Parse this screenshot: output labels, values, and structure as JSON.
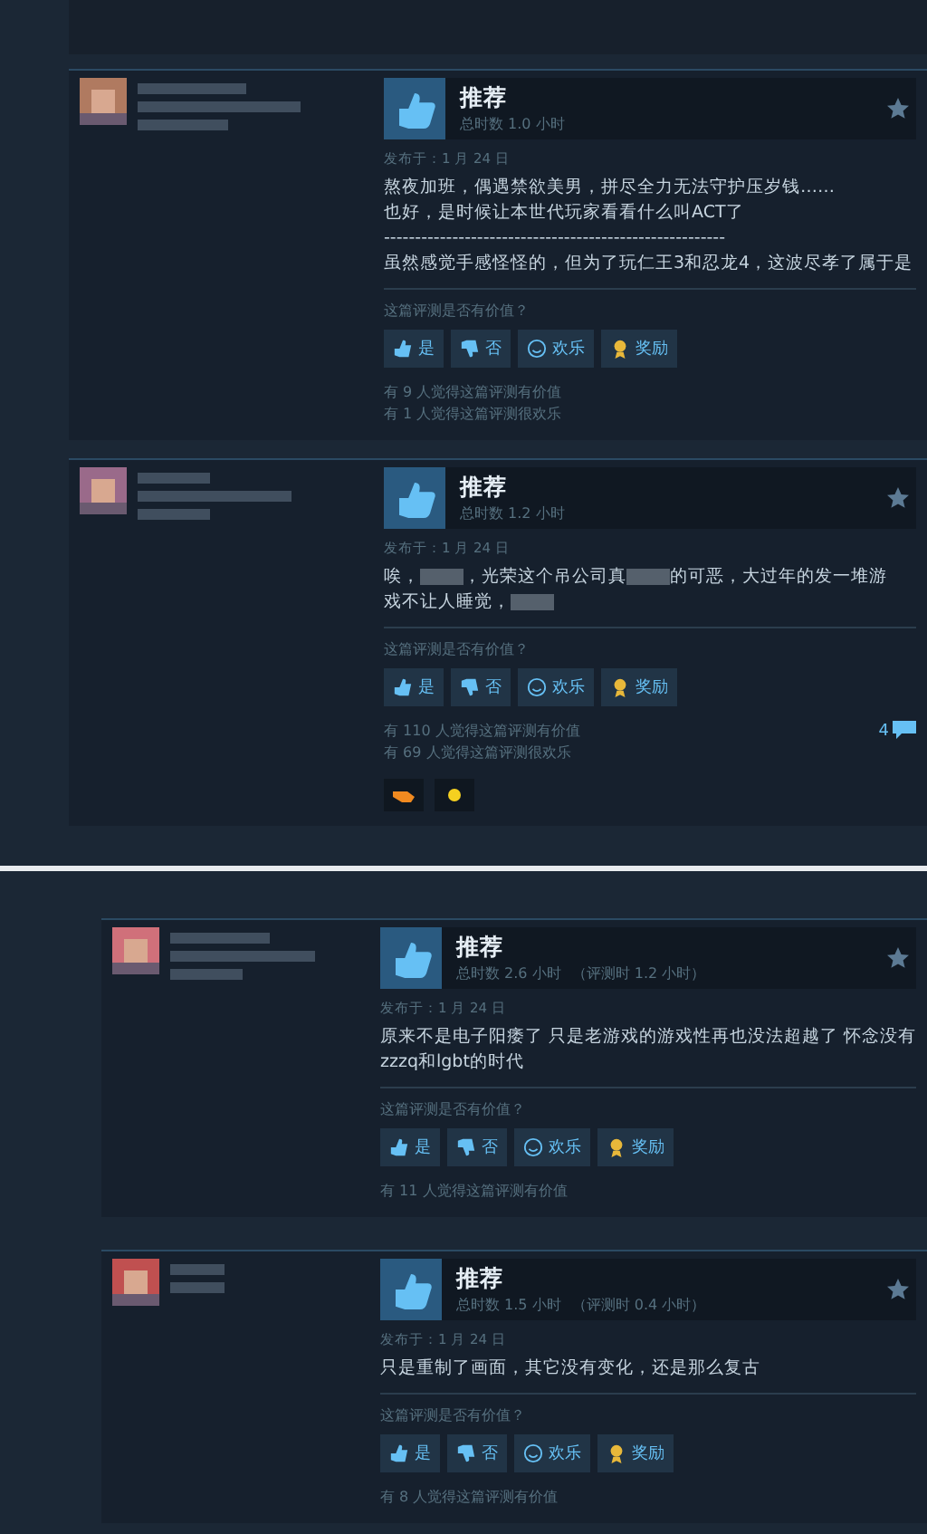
{
  "reviews": [
    {
      "verdict": "推荐",
      "playtime": "总时数 1.0 小时",
      "posted": "发布于：1 月 24 日",
      "body": [
        [
          {
            "kind": "text",
            "text": "熬夜加班，偶遇禁欲美男，拼尽全力无法守护压岁钱……"
          }
        ],
        [
          {
            "kind": "text",
            "text": "也好，是时候让本世代玩家看看什么叫ACT了"
          }
        ],
        [
          {
            "kind": "text",
            "text": "-------------------------------------------------------"
          }
        ],
        [
          {
            "kind": "text",
            "text": "虽然感觉手感怪怪的，但为了玩仁王3和忍龙4，这波尽孝了属于是"
          }
        ]
      ],
      "question": "这篇评测是否有价值？",
      "buttons": [
        {
          "kind": "yes",
          "label": "是"
        },
        {
          "kind": "no",
          "label": "否"
        },
        {
          "kind": "funny",
          "label": "欢乐"
        },
        {
          "kind": "award",
          "label": "奖励"
        }
      ],
      "stats": [
        "有 9 人觉得这篇评测有价值",
        "有 1 人觉得这篇评测很欢乐"
      ]
    },
    {
      "verdict": "推荐",
      "playtime": "总时数 1.2 小时",
      "posted": "发布于：1 月 24 日",
      "body": [
        [
          {
            "kind": "text",
            "text": "唉，"
          },
          {
            "kind": "blur"
          },
          {
            "kind": "text",
            "text": "，光荣这个吊公司真"
          },
          {
            "kind": "blur"
          },
          {
            "kind": "text",
            "text": "的可恶，大过年的发一堆游"
          }
        ],
        [
          {
            "kind": "text",
            "text": "戏不让人睡觉，"
          },
          {
            "kind": "blur"
          }
        ]
      ],
      "question": "这篇评测是否有价值？",
      "buttons": [
        {
          "kind": "yes",
          "label": "是"
        },
        {
          "kind": "no",
          "label": "否"
        },
        {
          "kind": "funny",
          "label": "欢乐"
        },
        {
          "kind": "award",
          "label": "奖励"
        }
      ],
      "stats": [
        "有 110 人觉得这篇评测有价值",
        "有 69 人觉得这篇评测很欢乐"
      ],
      "comments": "4",
      "awards": [
        {
          "kind": "hand"
        },
        {
          "kind": "sun"
        }
      ]
    },
    {
      "verdict": "推荐",
      "playtime": "总时数 2.6 小时",
      "playtime_at_review": "（评测时 1.2 小时）",
      "posted": "发布于：1 月 24 日",
      "body": [
        [
          {
            "kind": "text",
            "text": "原来不是电子阳痿了 只是老游戏的游戏性再也没法超越了 怀念没有"
          }
        ],
        [
          {
            "kind": "text",
            "text": "zzzq和lgbt的时代"
          }
        ]
      ],
      "question": "这篇评测是否有价值？",
      "buttons": [
        {
          "kind": "yes",
          "label": "是"
        },
        {
          "kind": "no",
          "label": "否"
        },
        {
          "kind": "funny",
          "label": "欢乐"
        },
        {
          "kind": "award",
          "label": "奖励"
        }
      ],
      "stats": [
        "有 11 人觉得这篇评测有价值"
      ]
    },
    {
      "verdict": "推荐",
      "playtime": "总时数 1.5 小时",
      "playtime_at_review": "（评测时 0.4 小时）",
      "posted": "发布于：1 月 24 日",
      "body": [
        [
          {
            "kind": "text",
            "text": "只是重制了画面，其它没有变化，还是那么复古"
          }
        ]
      ],
      "question": "这篇评测是否有价值？",
      "buttons": [
        {
          "kind": "yes",
          "label": "是"
        },
        {
          "kind": "no",
          "label": "否"
        },
        {
          "kind": "funny",
          "label": "欢乐"
        },
        {
          "kind": "award",
          "label": "奖励"
        }
      ],
      "stats": [
        "有 8 人觉得这篇评测有价值"
      ]
    }
  ]
}
